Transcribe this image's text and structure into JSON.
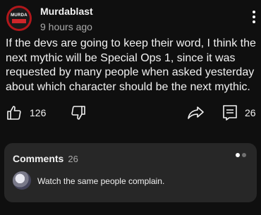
{
  "post": {
    "avatar_text": "MURDA",
    "author": "Murdablast",
    "time": "9 hours ago",
    "body": "If the devs are going to keep their word, I think the next mythic will be Special Ops 1, since it was requested by many people when asked yesterday about which character should be the next mythic."
  },
  "actions": {
    "like_count": "126",
    "comment_count": "26"
  },
  "comments": {
    "title": "Comments",
    "count": "26",
    "preview_text": "Watch the same people complain.",
    "pager": {
      "active_color": "#ffffff",
      "inactive_color": "#717171"
    }
  },
  "icons": {
    "like": "thumbs-up-icon",
    "dislike": "thumbs-down-icon",
    "share": "share-icon",
    "comment": "comment-icon",
    "menu": "more-vert-icon"
  }
}
